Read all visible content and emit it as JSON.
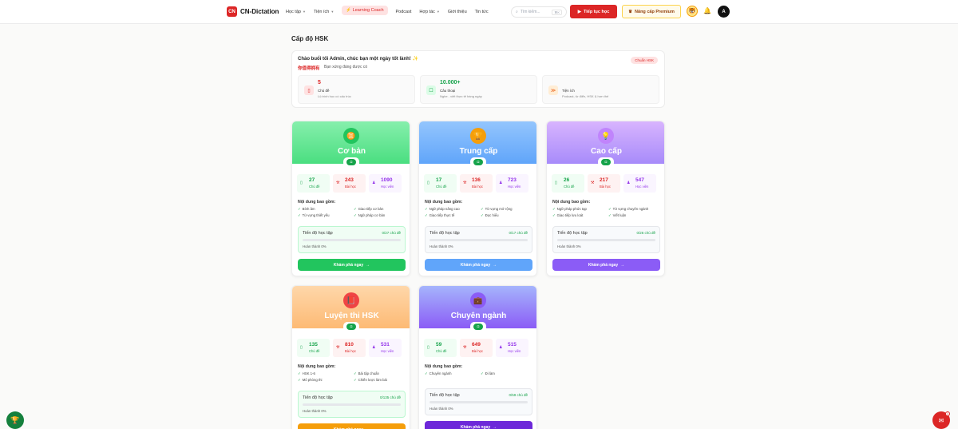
{
  "header": {
    "logo_text": "CN-Dictation",
    "logo_mark": "CN",
    "nav": [
      {
        "label": "Học tập",
        "dropdown": true
      },
      {
        "label": "Tiện ích",
        "dropdown": true
      },
      {
        "label": "Learning Coach",
        "highlight": true
      },
      {
        "label": "Podcast",
        "dropdown": false
      },
      {
        "label": "Hợp tác",
        "dropdown": true
      },
      {
        "label": "Giới thiệu",
        "dropdown": false
      },
      {
        "label": "Tin tức",
        "dropdown": false
      }
    ],
    "search_placeholder": "Tìm kiếm...",
    "search_shortcut": "⌘K",
    "continue_label": "Tiếp tục học",
    "premium_label": "Nâng cấp Premium",
    "user_initial": "A"
  },
  "page_title": "Cấp độ HSK",
  "welcome": {
    "greeting": "Chào buổi tối Admin, chúc bạn một ngày tốt lành! ✨",
    "chinese": "你值得拥有",
    "subtitle": "Bạn xứng đáng được có",
    "badge": "Chuẩn HSK",
    "stats": [
      {
        "value": "5",
        "label": "Chủ đề",
        "desc": "Lộ trình học có cấu trúc",
        "color": "#dc2626",
        "bg": "#fee2e2",
        "icon": "▯"
      },
      {
        "value": "10.000+",
        "label": "Câu thoại",
        "desc": "Nghe - viết thực tế hàng ngày",
        "color": "#16a34a",
        "bg": "#dcfce7",
        "icon": "☐"
      },
      {
        "value": "",
        "label": "Tiện ích",
        "desc": "Podcast, từ điển, HSK & hơn thế",
        "color": "#ea580c",
        "bg": "#ffedd5",
        "icon": "≫"
      }
    ]
  },
  "levels": [
    {
      "title": "Cơ bản",
      "icon": "♊",
      "grad": "linear-gradient(180deg,#86efac,#4ade80)",
      "accent": "#16a34a",
      "icon_bg": "#22c55e",
      "stats": [
        {
          "v": "27",
          "l": "Chủ đề"
        },
        {
          "v": "243",
          "l": "Bài học"
        },
        {
          "v": "1090",
          "l": "Học viên"
        }
      ],
      "content_heading": "Nội dung bao gồm:",
      "items": [
        "Bính âm",
        "Giao tiếp cơ bản",
        "Từ vựng thiết yếu",
        "Ngữ pháp cơ bản"
      ],
      "progress_title": "Tiến độ học tập",
      "progress_value": "0/27 chủ đề",
      "progress_done": "Hoàn thành 0%",
      "progress": 0,
      "cta": "Khám phá ngay",
      "cta_bg": "#22c55e",
      "prog_bg": "#f0fdf4",
      "prog_border": "#bbf7d0"
    },
    {
      "title": "Trung cấp",
      "icon": "🏆",
      "grad": "linear-gradient(180deg,#93c5fd,#60a5fa)",
      "accent": "#16a34a",
      "icon_bg": "#f59e0b",
      "stats": [
        {
          "v": "17",
          "l": "Chủ đề"
        },
        {
          "v": "136",
          "l": "Bài học"
        },
        {
          "v": "723",
          "l": "Học viên"
        }
      ],
      "content_heading": "Nội dung bao gồm:",
      "items": [
        "Ngữ pháp nâng cao",
        "Từ vựng mở rộng",
        "Giao tiếp thực tế",
        "Đọc hiểu"
      ],
      "progress_title": "Tiến độ học tập",
      "progress_value": "0/17 chủ đề",
      "progress_done": "Hoàn thành 0%",
      "progress": 0,
      "cta": "Khám phá ngay",
      "cta_bg": "#60a5fa",
      "prog_bg": "#f8fafc",
      "prog_border": "#e5e7eb"
    },
    {
      "title": "Cao cấp",
      "icon": "💡",
      "grad": "linear-gradient(180deg,#d8b4fe,#a78bfa)",
      "accent": "#16a34a",
      "icon_bg": "#c084fc",
      "stats": [
        {
          "v": "26",
          "l": "Chủ đề"
        },
        {
          "v": "217",
          "l": "Bài học"
        },
        {
          "v": "547",
          "l": "Học viên"
        }
      ],
      "content_heading": "Nội dung bao gồm:",
      "items": [
        "Ngữ pháp phức tạp",
        "Từ vựng chuyên ngành",
        "Giao tiếp lưu loát",
        "Viết luận"
      ],
      "progress_title": "Tiến độ học tập",
      "progress_value": "0/26 chủ đề",
      "progress_done": "Hoàn thành 0%",
      "progress": 0,
      "cta": "Khám phá ngay",
      "cta_bg": "#8b5cf6",
      "prog_bg": "#f8fafc",
      "prog_border": "#e5e7eb"
    },
    {
      "title": "Luyện thi HSK",
      "icon": "📕",
      "grad": "linear-gradient(180deg,#fed7aa,#fdba74)",
      "accent": "#16a34a",
      "icon_bg": "#ef4444",
      "stats": [
        {
          "v": "135",
          "l": "Chủ đề"
        },
        {
          "v": "810",
          "l": "Bài học"
        },
        {
          "v": "531",
          "l": "Học viên"
        }
      ],
      "content_heading": "Nội dung bao gồm:",
      "items": [
        "HSK 1-6",
        "Bài tập chuẩn",
        "Mô phỏng thi",
        "Chiến lược làm bài"
      ],
      "progress_title": "Tiến độ học tập",
      "progress_value": "0/135 chủ đề",
      "progress_done": "Hoàn thành 0%",
      "progress": 0,
      "cta": "Khám phá ngay",
      "cta_bg": "#f59e0b",
      "prog_bg": "#f0fdf4",
      "prog_border": "#bbf7d0"
    },
    {
      "title": "Chuyên ngành",
      "icon": "💼",
      "grad": "linear-gradient(180deg,#a5b4fc,#8b5cf6)",
      "accent": "#16a34a",
      "icon_bg": "#8b5cf6",
      "stats": [
        {
          "v": "59",
          "l": "Chủ đề"
        },
        {
          "v": "649",
          "l": "Bài học"
        },
        {
          "v": "515",
          "l": "Học viên"
        }
      ],
      "content_heading": "Nội dung bao gồm:",
      "items": [
        "Chuyên ngành",
        "Đi làm"
      ],
      "progress_title": "Tiến độ học tập",
      "progress_value": "0/59 chủ đề",
      "progress_done": "Hoàn thành 0%",
      "progress": 0,
      "cta": "Khám phá ngay",
      "cta_bg": "#6d28d9",
      "prog_bg": "#f8fafc",
      "prog_border": "#e5e7eb"
    }
  ],
  "fab_right_badge": "1"
}
